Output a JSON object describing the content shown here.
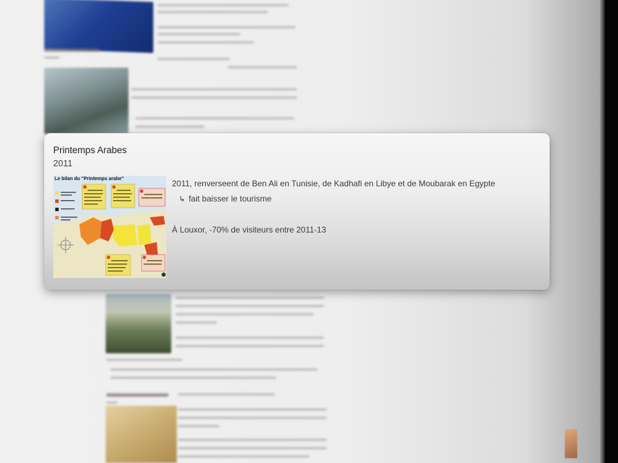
{
  "card": {
    "title": "Printemps Arabes",
    "year": "2011",
    "lines": [
      "2011, renverseent de Ben Ali en Tunisie, de Kadhafi en Libye et de Moubarak en Egypte",
      "fait baisser le tourisme",
      "À Louxor, -70% de visiteurs entre 2011-13"
    ],
    "sub_arrow": "↳",
    "thumbnail": {
      "title": "Le bilan du \"Printemps arabe\"",
      "legend": [
        "Régime autoritaire renversé",
        "Révolte en cours",
        "Révolte écrasée",
        "Assouplissement du régime"
      ],
      "boxes": [
        "Tunisie",
        "Libye",
        "Syrie",
        "Egypte",
        "Yémen"
      ],
      "colors": {
        "sea": "#d9e6ef",
        "land": "#ece6c4",
        "red": "#d94a22",
        "orange": "#ef8a2c",
        "yellow": "#f3e43a",
        "box": "#f0e16a"
      }
    }
  },
  "background": {
    "colors": {
      "page": "#efefef",
      "blue_image": "#1f3f94",
      "edge": "#050505"
    }
  }
}
